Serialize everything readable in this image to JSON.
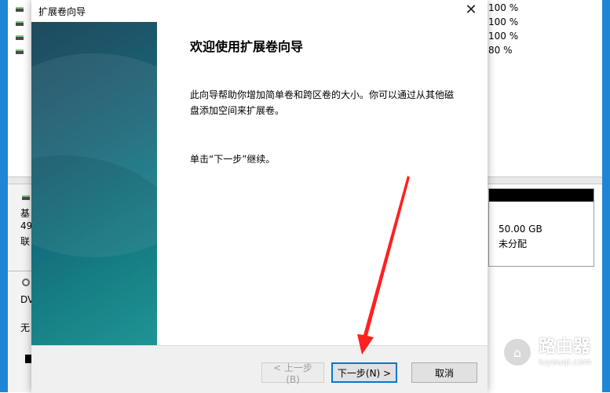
{
  "background": {
    "volume_percents": [
      "100 %",
      "100 %",
      "100 %",
      "80 %"
    ],
    "disk_labels": [
      "基",
      "49",
      "联"
    ],
    "dvd_labels": [
      "DV",
      "无"
    ],
    "unallocated": {
      "size": "50.00 GB",
      "label": "未分配"
    },
    "watermark": {
      "name": "路由器",
      "domain": "luyouqi.com"
    }
  },
  "dialog": {
    "title": "扩展卷向导",
    "close_glyph": "✕",
    "heading": "欢迎使用扩展卷向导",
    "description": "此向导帮助你增加简单卷和跨区卷的大小。你可以通过从其他磁盘添加空间来扩展卷。",
    "continue_text": "单击“下一步”继续。",
    "buttons": {
      "back": "< 上一步(B)",
      "next": "下一步(N) >",
      "cancel": "取消"
    }
  },
  "colors": {
    "arrow": "#ff2020",
    "accent": "#0078d7",
    "sidebar_art": "#1b6175"
  }
}
